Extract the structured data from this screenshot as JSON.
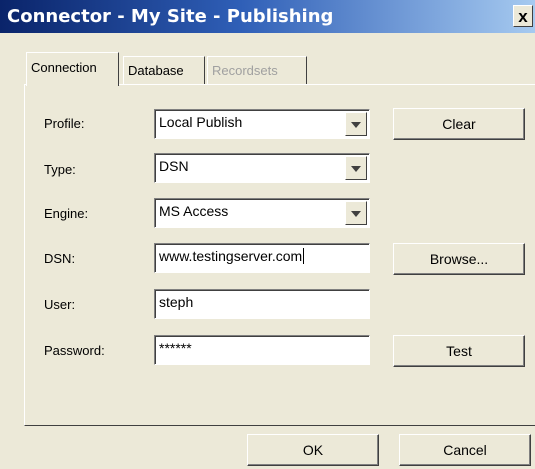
{
  "window": {
    "title": "Connector - My Site - Publishing",
    "close_label": "x"
  },
  "tabs": [
    {
      "label": "Connection",
      "state": "active"
    },
    {
      "label": "Database",
      "state": "normal"
    },
    {
      "label": "Recordsets",
      "state": "disabled"
    }
  ],
  "form": {
    "profile": {
      "label": "Profile:",
      "value": "Local Publish"
    },
    "type": {
      "label": "Type:",
      "value": "DSN"
    },
    "engine": {
      "label": "Engine:",
      "value": "MS Access"
    },
    "dsn": {
      "label": "DSN:",
      "value": "www.testingserver.com"
    },
    "user": {
      "label": "User:",
      "value": "steph"
    },
    "password": {
      "label": "Password:",
      "value": "******"
    }
  },
  "buttons": {
    "clear": "Clear",
    "browse": "Browse...",
    "test": "Test",
    "ok": "OK",
    "cancel": "Cancel"
  },
  "colors": {
    "dialog_bg": "#ece9d8",
    "title_start": "#0a246a",
    "title_end": "#a6caf0"
  }
}
